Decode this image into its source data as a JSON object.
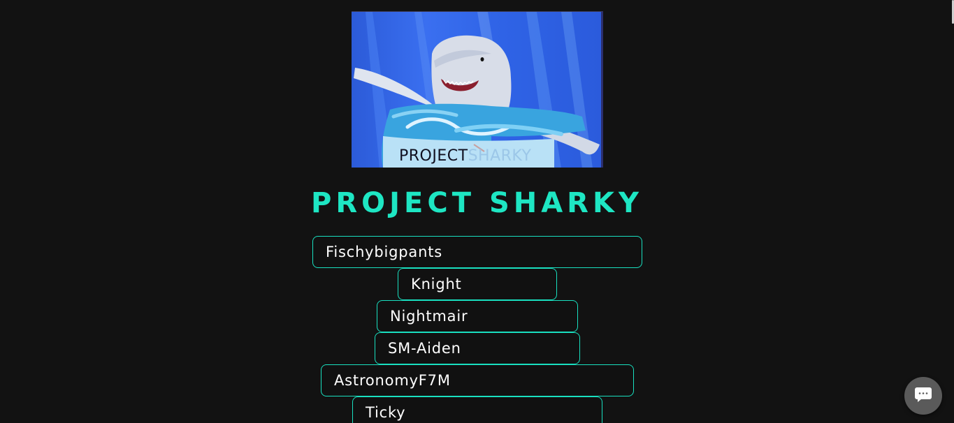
{
  "banner": {
    "caption_word1": "PROJECT",
    "caption_word2": "SHARKY",
    "colors": {
      "sky": "#2f63e6",
      "shark": "#d8dde8",
      "water": "#3aa0d8"
    }
  },
  "title": "PROJECT SHARKY",
  "members": [
    {
      "name": "Fischybigpants"
    },
    {
      "name": "Knight"
    },
    {
      "name": "Nightmair"
    },
    {
      "name": "SM-Aiden"
    },
    {
      "name": "AstronomyF7M"
    },
    {
      "name": "Ticky"
    }
  ],
  "chat": {
    "icon": "chat-bubble-icon"
  },
  "colors": {
    "background": "#121212",
    "accent": "#1ee6c3",
    "text": "#ffffff"
  }
}
